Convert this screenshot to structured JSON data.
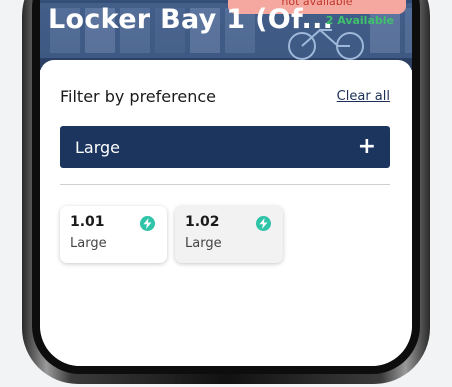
{
  "header": {
    "title": "Locker Bay 1 (Of...",
    "availability": "2 Available",
    "toast": "not available"
  },
  "filter": {
    "title": "Filter by preference",
    "clear_label": "Clear all",
    "selected_size": "Large",
    "expand_symbol": "+"
  },
  "lockers": [
    {
      "number": "1.01",
      "size": "Large",
      "icon": "charging-bolt-icon"
    },
    {
      "number": "1.02",
      "size": "Large",
      "icon": "charging-bolt-icon"
    }
  ],
  "colors": {
    "primary": "#1b355f",
    "charge_badge": "#2fc3a7",
    "available": "#3fc06c",
    "toast_bg": "#f4a8a0"
  }
}
